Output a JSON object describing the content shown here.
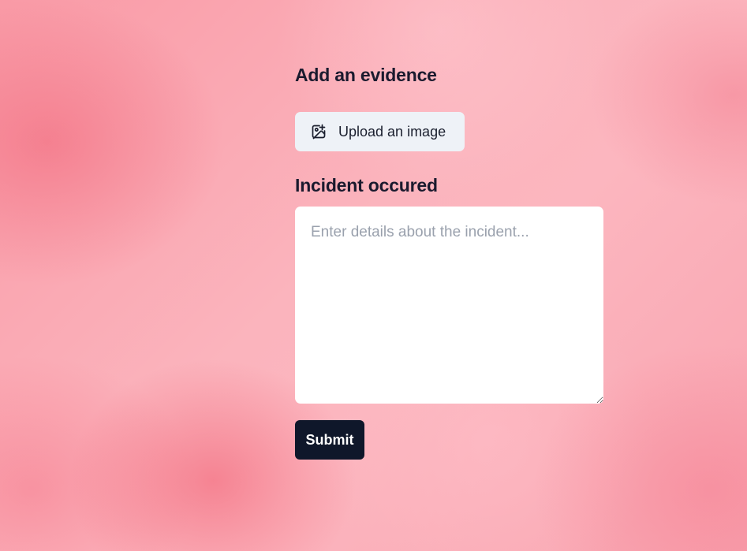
{
  "evidence": {
    "heading": "Add an evidence",
    "upload_label": "Upload an image",
    "upload_icon": "image-plus-icon"
  },
  "incident": {
    "heading": "Incident occured",
    "placeholder": "Enter details about the incident...",
    "value": ""
  },
  "actions": {
    "submit_label": "Submit"
  },
  "colors": {
    "background": "#fbb4bd",
    "heading_text": "#1a1a2e",
    "upload_button_bg": "#eef2f7",
    "submit_button_bg": "#0f172a",
    "placeholder_text": "#9aa1ad"
  }
}
